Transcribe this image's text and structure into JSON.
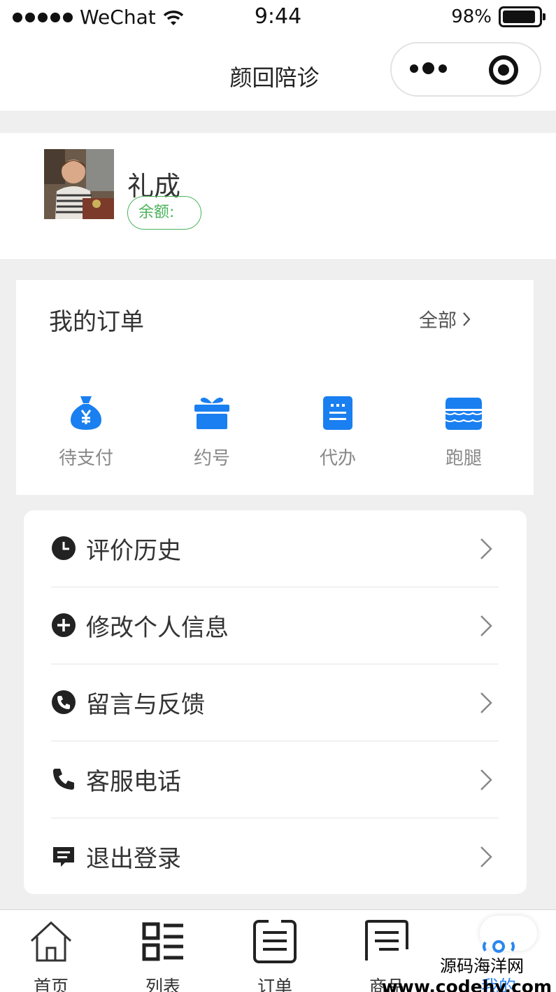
{
  "status_bar": {
    "carrier": "WeChat",
    "time": "9:44",
    "battery_percent": "98%",
    "battery_level": 0.98
  },
  "nav": {
    "title": "颜回陪诊"
  },
  "profile": {
    "name": "礼成",
    "balance_label": "余额:"
  },
  "orders": {
    "title": "我的订单",
    "all_label": "全部",
    "items": [
      {
        "label": "待支付",
        "icon": "money-bag-icon"
      },
      {
        "label": "约号",
        "icon": "gift-icon"
      },
      {
        "label": "代办",
        "icon": "task-icon"
      },
      {
        "label": "跑腿",
        "icon": "store-icon"
      }
    ]
  },
  "menu": [
    {
      "label": "评价历史",
      "icon": "clock-icon"
    },
    {
      "label": "修改个人信息",
      "icon": "plus-circle-icon"
    },
    {
      "label": "留言与反馈",
      "icon": "phone-circle-icon"
    },
    {
      "label": "客服电话",
      "icon": "phone-icon"
    },
    {
      "label": "退出登录",
      "icon": "message-icon"
    }
  ],
  "tabs": [
    {
      "label": "首页",
      "icon": "home-icon"
    },
    {
      "label": "列表",
      "icon": "list-icon"
    },
    {
      "label": "订单",
      "icon": "order-icon"
    },
    {
      "label": "商品",
      "icon": "goods-icon"
    },
    {
      "label": "我的",
      "icon": "profile-icon",
      "active": true
    }
  ],
  "watermark": {
    "line1": "源码海洋网",
    "line2": "www.codehy.com"
  },
  "colors": {
    "accent": "#2b86f0",
    "balance": "#4bb35a",
    "background": "#efefef"
  }
}
